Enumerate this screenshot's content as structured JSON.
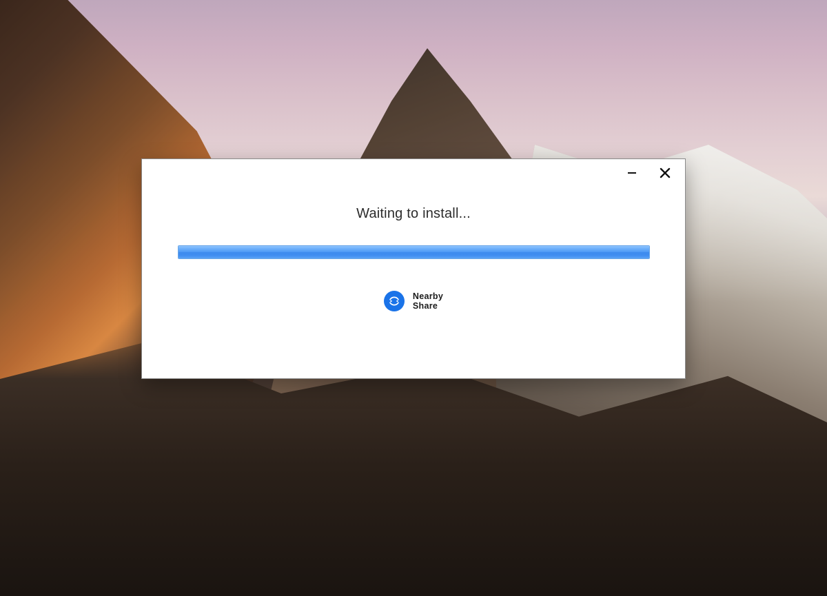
{
  "window": {
    "status_text": "Waiting to install...",
    "progress_percent": 100,
    "controls": {
      "minimize_name": "minimize",
      "close_name": "close"
    }
  },
  "app": {
    "name_line1": "Nearby",
    "name_line2": "Share",
    "icon_name": "nearby-share-icon"
  },
  "colors": {
    "accent_blue": "#1a73e8",
    "progress_blue": "#4f9af5"
  }
}
